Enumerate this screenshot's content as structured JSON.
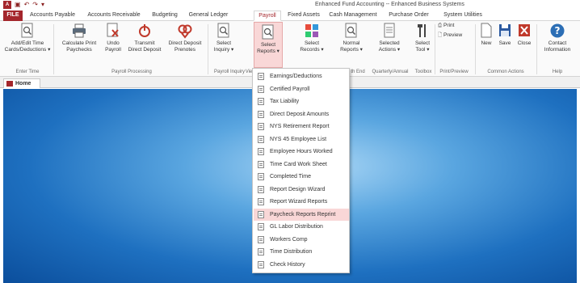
{
  "window": {
    "title": "Enhanced Fund Accounting -- Enhanced Business Systems"
  },
  "qat": {
    "app_letter": "A",
    "save": "▣",
    "undo": "↶",
    "redo": "↷",
    "touch": "▾"
  },
  "tabs": [
    {
      "label": "FILE"
    },
    {
      "label": "Accounts Payable"
    },
    {
      "label": "Accounts Receivable"
    },
    {
      "label": "Budgeting"
    },
    {
      "label": "General Ledger"
    },
    {
      "label": "Payroll"
    },
    {
      "label": "Fixed Assets"
    },
    {
      "label": "Cash Management"
    },
    {
      "label": "Purchase Order"
    },
    {
      "label": "System Utilities"
    }
  ],
  "ribbon": {
    "add_edit": {
      "line1": "Add/Edit Time",
      "line2": "Cards/Deductions ▾"
    },
    "calc_print": {
      "line1": "Calculate Print",
      "line2": "Paychecks"
    },
    "undo_payroll": {
      "line1": "Undo",
      "line2": "Payroll"
    },
    "transmit": {
      "line1": "Transmit",
      "line2": "Direct Deposit"
    },
    "direct_deposit": {
      "line1": "Direct Deposit",
      "line2": "Prenotes"
    },
    "select_inquiry": {
      "line1": "Select",
      "line2": "Inquiry ▾"
    },
    "select_reports": {
      "line1": "Select",
      "line2": "Reports ▾"
    },
    "select_records": {
      "line1": "Select",
      "line2": "Records ▾"
    },
    "normal_reports": {
      "line1": "Normal",
      "line2": "Reports ▾"
    },
    "selected_actions": {
      "line1": "Selected",
      "line2": "Actions ▾"
    },
    "select_tool": {
      "line1": "Select",
      "line2": "Tool ▾"
    },
    "print": "Print",
    "preview": "Preview",
    "new": "New",
    "save": "Save",
    "close": "Close",
    "contact": {
      "line1": "Contact",
      "line2": "Information"
    },
    "groups": {
      "enter_time": "Enter Time",
      "payroll_processing": "Payroll Processing",
      "payroll_inquiry": "Payroll Inquiry",
      "view": "Vie",
      "month_end": "th End",
      "quarterly": "Quarterly/Annual",
      "toolbox": "Toolbox",
      "print_preview": "Print/Preview",
      "common_actions": "Common Actions",
      "help": "Help"
    }
  },
  "doc": {
    "home_tab": "Home"
  },
  "dropdown": {
    "items": [
      {
        "label": "Earnings/Deductions"
      },
      {
        "label": "Certified Payroll"
      },
      {
        "label": "Tax Liability"
      },
      {
        "label": "Direct Deposit Amounts"
      },
      {
        "label": "NYS Retirement Report"
      },
      {
        "label": "NYS 45 Employee List"
      },
      {
        "label": "Employee Hours Worked"
      },
      {
        "label": "Time Card Work Sheet"
      },
      {
        "label": "Completed Time"
      },
      {
        "label": "Report Design Wizard"
      },
      {
        "label": "Report Wizard Reports"
      },
      {
        "label": "Paycheck Reports Reprint"
      },
      {
        "label": "GL Labor Distribution"
      },
      {
        "label": "Workers Comp"
      },
      {
        "label": "Time Distribution"
      },
      {
        "label": "Check History"
      }
    ]
  },
  "colors": {
    "accent": "#a4262c",
    "highlight": "#f9d7d7",
    "workspace": "#1e70c0"
  }
}
